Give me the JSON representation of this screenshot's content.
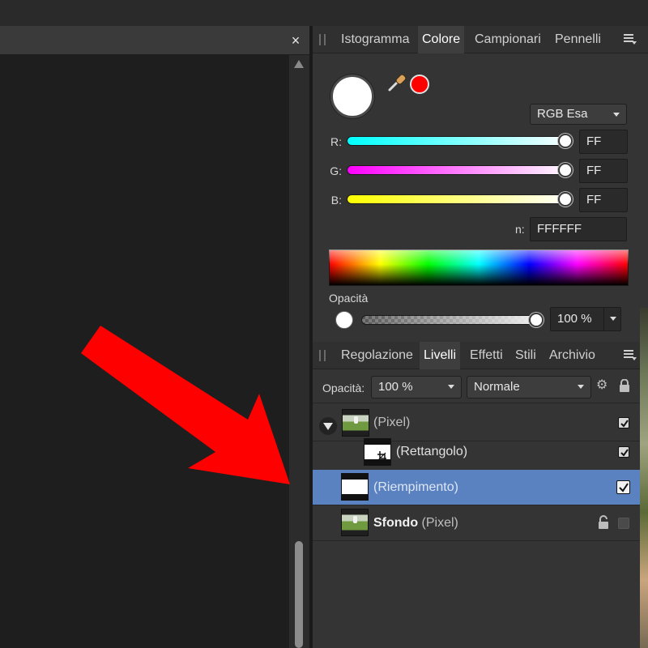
{
  "doc": {
    "close_label": "×"
  },
  "color_panel": {
    "tabs": [
      "Istogramma",
      "Colore",
      "Campionari",
      "Pennelli"
    ],
    "active_tab": "Colore",
    "primary_color": "#ffffff",
    "secondary_color": "#ff0000",
    "mode": "RGB Esa",
    "channels": [
      {
        "label": "R:",
        "value": "FF"
      },
      {
        "label": "G:",
        "value": "FF"
      },
      {
        "label": "B:",
        "value": "FF"
      }
    ],
    "hex_label": "n:",
    "hex_value": "FFFFFF",
    "opacity_label": "Opacità",
    "opacity_value": "100 %"
  },
  "layers_panel": {
    "tabs": [
      "Regolazione",
      "Livelli",
      "Effetti",
      "Stili",
      "Archivio"
    ],
    "active_tab": "Livelli",
    "opacity_label": "Opacità:",
    "opacity_value": "100 %",
    "blend_mode": "Normale",
    "layers": [
      {
        "name": "",
        "type": "(Pixel)",
        "visible": true
      },
      {
        "name": "",
        "type": "(Rettangolo)",
        "visible": true
      },
      {
        "name": "",
        "type": "(Riempimento)",
        "visible": true,
        "selected": true
      },
      {
        "name": "Sfondo",
        "type": "(Pixel)",
        "visible": false,
        "locked": true
      }
    ]
  },
  "annotation": {
    "arrow_color": "#ff0000"
  }
}
